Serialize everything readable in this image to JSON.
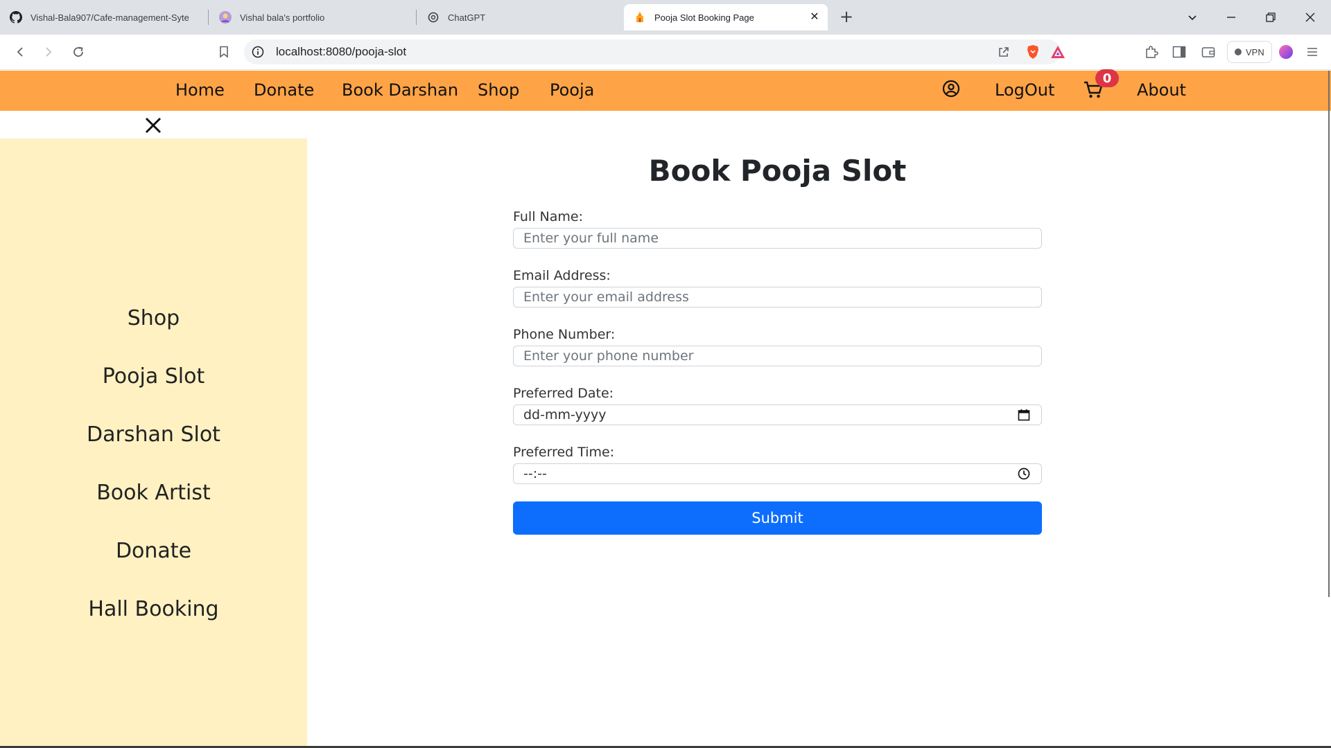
{
  "browser": {
    "tabs": [
      {
        "title": "Vishal-Bala907/Cafe-management-Syte",
        "icon": "github-icon"
      },
      {
        "title": "Vishal bala's portfolio",
        "icon": "avatar-icon"
      },
      {
        "title": "ChatGPT",
        "icon": "chatgpt-icon"
      },
      {
        "title": "Pooja Slot Booking Page",
        "icon": "temple-icon",
        "active": true
      }
    ],
    "url": "localhost:8080/pooja-slot",
    "vpn_label": "VPN"
  },
  "navbar": {
    "links": [
      "Home",
      "Donate",
      "Book Darshan",
      "Shop",
      "Pooja"
    ],
    "logout": "LogOut",
    "cart_count": "0",
    "about": "About",
    "background": "#ffa446"
  },
  "sidebar": {
    "items": [
      "Shop",
      "Pooja Slot",
      "Darshan Slot",
      "Book Artist",
      "Donate",
      "Hall Booking"
    ],
    "background": "#fff1c2"
  },
  "form": {
    "title": "Book Pooja Slot",
    "fields": [
      {
        "label": "Full Name:",
        "placeholder": "Enter your full name"
      },
      {
        "label": "Email Address:",
        "placeholder": "Enter your email address"
      },
      {
        "label": "Phone Number:",
        "placeholder": "Enter your phone number"
      },
      {
        "label": "Preferred Date:",
        "value": "dd-mm-yyyy"
      },
      {
        "label": "Preferred Time:",
        "value": "--:--"
      }
    ],
    "submit": "Submit",
    "submit_color": "#0d6efd"
  }
}
